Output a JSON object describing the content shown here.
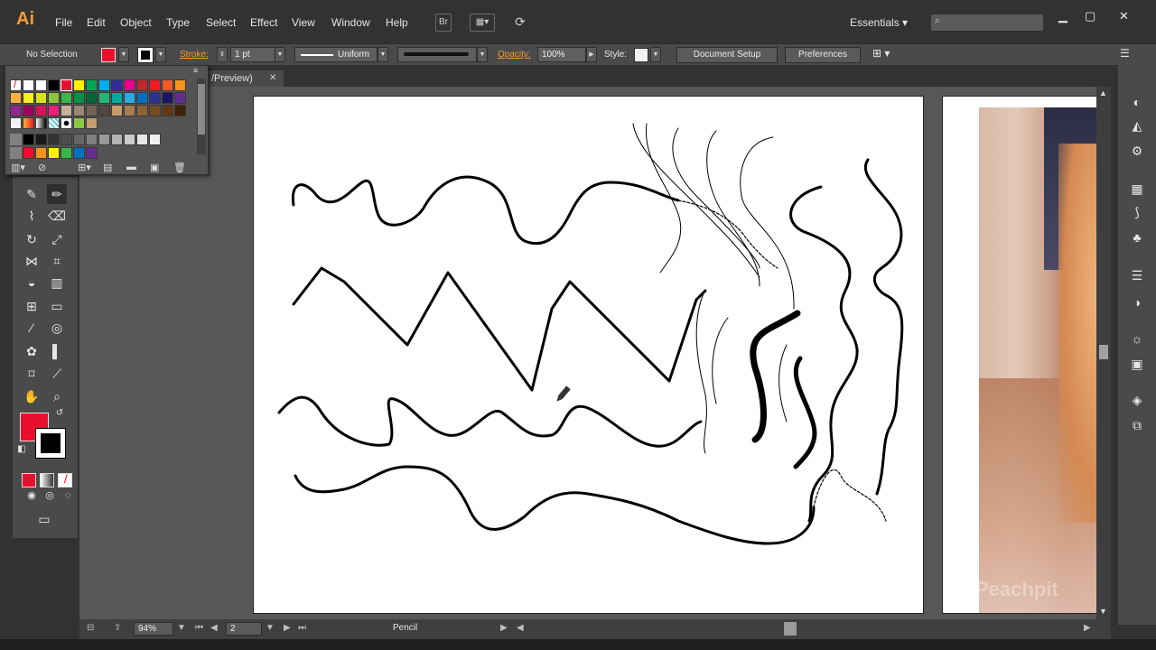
{
  "app": {
    "logo": "Ai",
    "menus": [
      "File",
      "Edit",
      "Object",
      "Type",
      "Select",
      "Effect",
      "View",
      "Window",
      "Help"
    ],
    "bridge_label": "Br",
    "workspace": "Essentials"
  },
  "control_bar": {
    "selection": "No Selection",
    "stroke_label": "Stroke:",
    "stroke_weight": "1 pt",
    "profile": "Uniform",
    "opacity_label": "Opacity:",
    "opacity": "100%",
    "style_label": "Style:",
    "document_setup": "Document Setup",
    "preferences": "Preferences"
  },
  "document": {
    "tab_label": "/Preview)",
    "close": "✕"
  },
  "status_bar": {
    "zoom": "94%",
    "artboard": "2",
    "tool_name": "Pencil"
  },
  "watermark": "Peachpit",
  "colors": {
    "fill": "#e8102e",
    "stroke": "#000000",
    "accent": "#f29d2f"
  }
}
